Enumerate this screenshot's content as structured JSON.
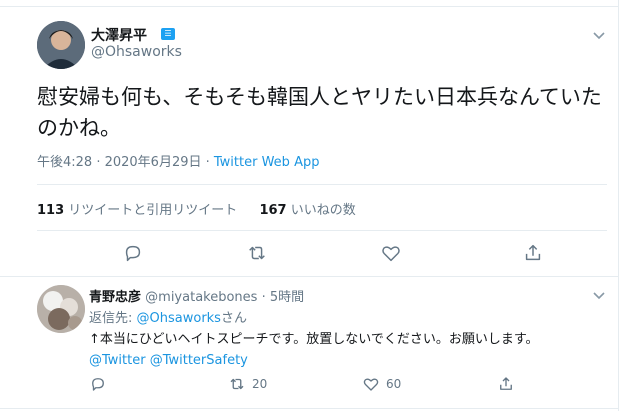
{
  "tweet": {
    "author_name": "大澤昇平",
    "author_handle": "@Ohsaworks",
    "text": "慰安婦も何も、そもそも韓国人とヤリたい日本兵なんていたのかね。",
    "time": "午後4:28 · 2020年6月29日 · ",
    "app": "Twitter Web App",
    "retweets_count": "113",
    "retweets_label": "リツイートと引用リツイート",
    "likes_count": "167",
    "likes_label": "いいねの数"
  },
  "reply": {
    "author_name": "青野忠彦",
    "author_handle": "@miyatakebones · 5時間",
    "reply_prefix": "返信先: ",
    "reply_mention": "@Ohsaworks",
    "reply_suffix": "さん",
    "text": "↑本当にひどいヘイトスピーチです。放置しないでください。お願いします。",
    "mentions": "@Twitter @TwitterSafety",
    "retweet_count": "20",
    "like_count": "60"
  },
  "colors": {
    "accent": "#1da1f2",
    "link": "#1b95e0",
    "muted": "#657786",
    "border": "#e6ecf0"
  }
}
